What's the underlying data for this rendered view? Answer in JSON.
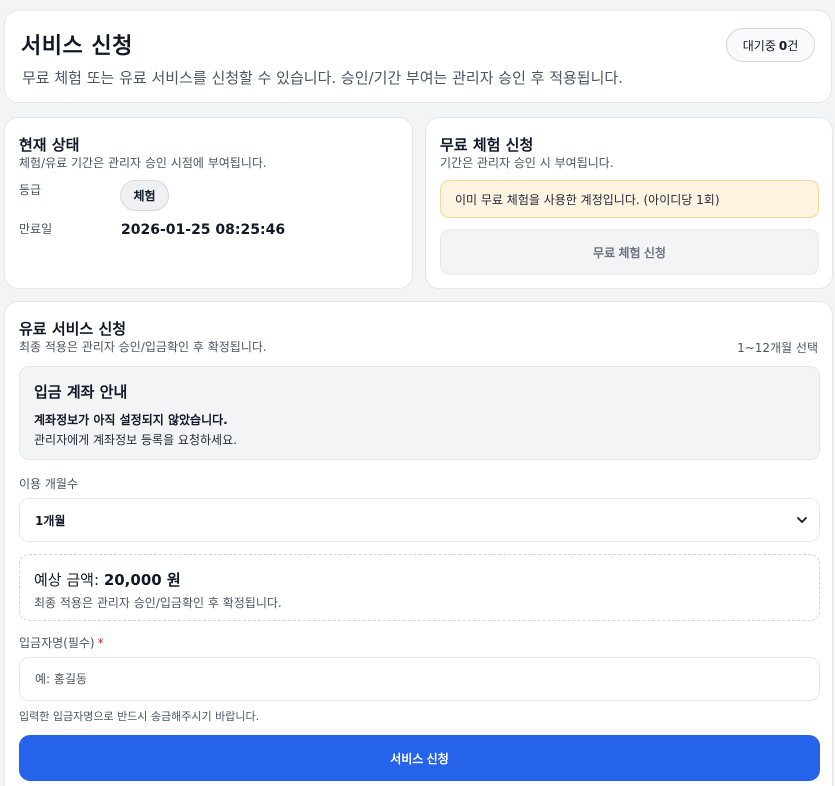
{
  "header": {
    "title": "서비스 신청",
    "subtitle": "무료 체험 또는 유료 서비스를 신청할 수 있습니다. 승인/기간 부여는 관리자 승인 후 적용됩니다.",
    "pending_label": "대기중",
    "pending_count": "0",
    "pending_unit": "건"
  },
  "status": {
    "title": "현재 상태",
    "description": "체험/유료 기간은 관리자 승인 시점에 부여됩니다.",
    "grade_label": "등급",
    "grade_value": "체험",
    "expiry_label": "만료일",
    "expiry_value": "2026-01-25 08:25:46"
  },
  "trial": {
    "title": "무료 체험 신청",
    "description": "기간은 관리자 승인 시 부여됩니다.",
    "notice": "이미 무료 체험을 사용한 계정입니다. (아이디당 1회)",
    "button_label": "무료 체험 신청"
  },
  "paid": {
    "title": "유료 서비스 신청",
    "description": "최종 적용은 관리자 승인/입금확인 후 확정됩니다.",
    "range": "1~12개월 선택",
    "account": {
      "title": "입금 계좌 안내",
      "line1": "계좌정보가 아직 설정되지 않았습니다.",
      "line2": "관리자에게 계좌정보 등록을 요청하세요."
    },
    "months_label": "이용 개월수",
    "months_value": "1개월",
    "estimate_label": "예상 금액:",
    "estimate_value": "20,000 원",
    "estimate_note": "최종 적용은 관리자 승인/입금확인 후 확정됩니다.",
    "depositor_label": "입금자명(필수)",
    "depositor_required": "*",
    "depositor_placeholder": "예: 홍길동",
    "depositor_help": "입력한 입금자명으로 반드시 송금해주시기 바랍니다.",
    "submit_label": "서비스 신청"
  },
  "colors": {
    "primary": "#2563eb",
    "notice_bg": "#fdf3e1",
    "notice_border": "#f5d79b",
    "required": "#dc2626"
  }
}
